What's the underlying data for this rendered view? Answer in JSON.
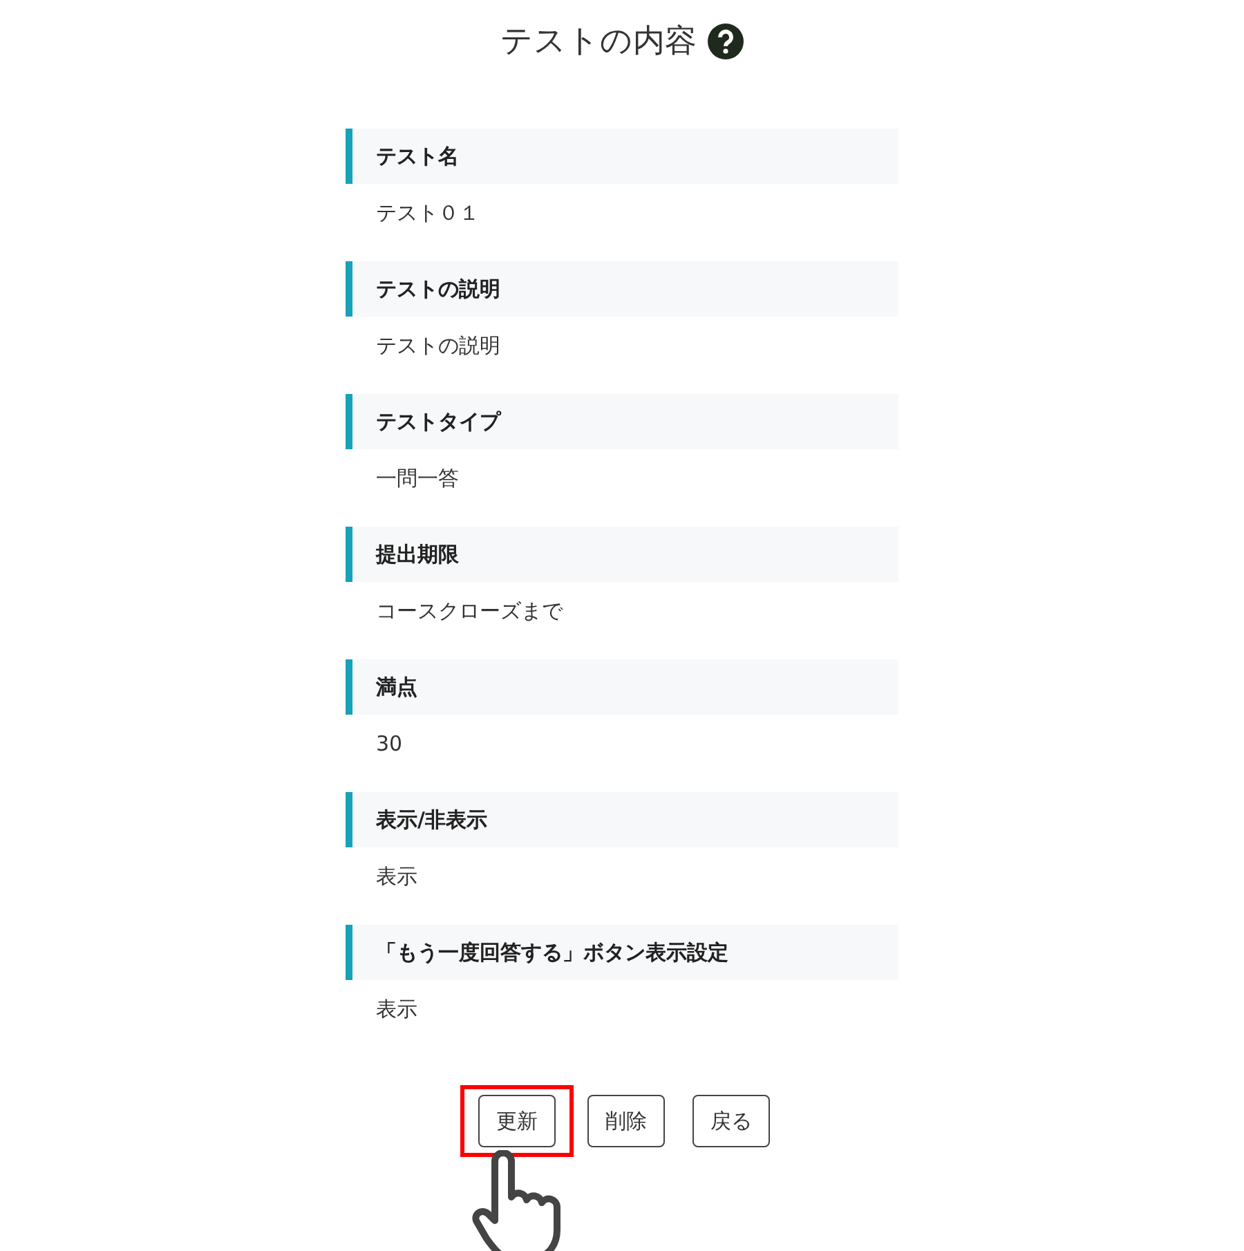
{
  "title": "テストの内容",
  "fields": [
    {
      "label": "テスト名",
      "value": "テスト０１"
    },
    {
      "label": "テストの説明",
      "value": "テストの説明"
    },
    {
      "label": "テストタイプ",
      "value": "一問一答"
    },
    {
      "label": "提出期限",
      "value": "コースクローズまで"
    },
    {
      "label": "満点",
      "value": "30"
    },
    {
      "label": "表示/非表示",
      "value": "表示"
    },
    {
      "label": "「もう一度回答する」ボタン表示設定",
      "value": "表示"
    }
  ],
  "buttons": [
    {
      "label": "更新",
      "highlighted": true
    },
    {
      "label": "削除",
      "highlighted": false
    },
    {
      "label": "戻る",
      "highlighted": false
    }
  ]
}
